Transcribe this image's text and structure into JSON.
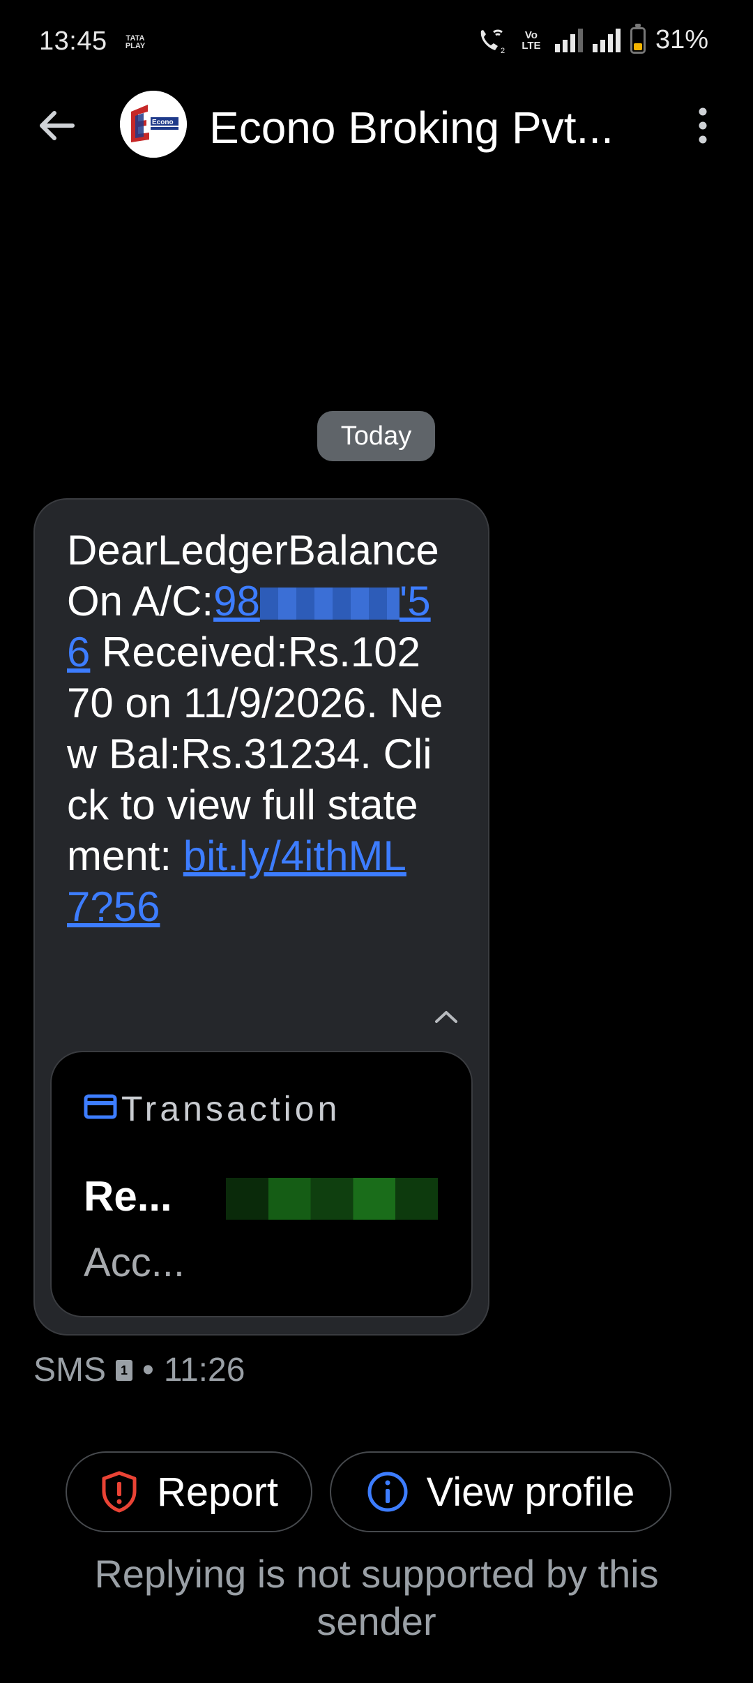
{
  "status_bar": {
    "time": "13:45",
    "carrier": "TATA PLAY",
    "volte": "Vo LTE",
    "battery_percent": "31%",
    "battery_level": 0.31,
    "colors": {
      "battery": "#f4b400"
    }
  },
  "header": {
    "title": "Econo Broking Pvt...",
    "avatar_text": "Econo"
  },
  "date_chip": "Today",
  "message": {
    "line1": "DearLedgerBalanceOn A/C:",
    "account_prefix": "98",
    "account_suffix": "'56",
    "line2": "Received:Rs.10270 on 11/9/2026. New Bal:Rs.31234. Click to view full statement: ",
    "link": "bit.ly/4ithML7?56"
  },
  "card": {
    "title": "Transaction",
    "row1": "Re...",
    "row2": "Acc..."
  },
  "meta": {
    "channel": "SMS",
    "sim": "1",
    "separator": "•",
    "time": "11:26"
  },
  "actions": {
    "report": "Report",
    "view_profile": "View profile"
  },
  "footer": "Replying is not supported by this sender",
  "colors": {
    "link": "#3d7dff",
    "report_icon": "#ea4335",
    "info_icon": "#3d7dff",
    "bubble_bg": "#25272b"
  }
}
